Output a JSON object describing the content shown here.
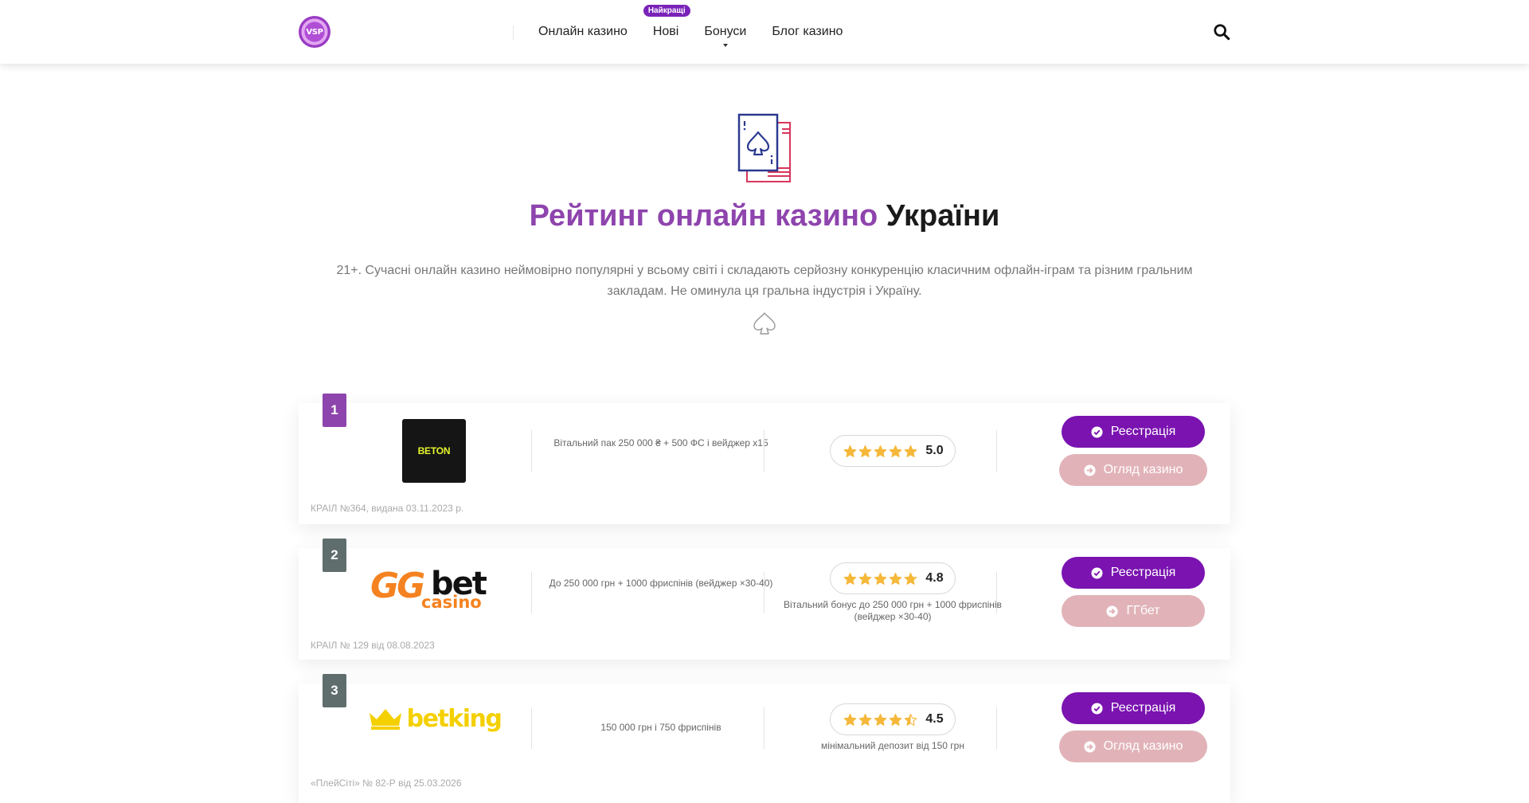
{
  "header": {
    "logo_text": "VSP",
    "nav": [
      {
        "label": "Онлайн казино"
      },
      {
        "label": "Нові",
        "badge": "Найкращі"
      },
      {
        "label": "Бонуси"
      },
      {
        "label": "Блог казино"
      }
    ],
    "search_icon": "search-icon"
  },
  "hero": {
    "icon": "playing-cards-icon",
    "title_accent": "Рейтинг онлайн казино",
    "title_rest": "України",
    "subtitle": "21+. Сучасні онлайн казино неймовірно популярні у всьому світі і складають серйозну конкуренцію класичним офлайн-іграм та різним гральним закладам. Не оминула ця гральна індустрія і Україну.",
    "divider_icon": "spade-outline-icon"
  },
  "casinos": [
    {
      "rank": "1",
      "logo_text": "BETON",
      "bonus": "Вітальний пак 250 000 ₴ + 500 ФС і вейджер x15",
      "rating": 5.0,
      "score": "5.0",
      "rating_note": "",
      "register_label": "Реєстрація",
      "review_label": "Огляд казино",
      "license": "КРАІЛ №364, видана 03.11.2023 р."
    },
    {
      "rank": "2",
      "logo_text": {
        "gg": "GG",
        "bet": "bet",
        "casino": "casino"
      },
      "bonus": "До 250 000 грн + 1000 фриспінів (вейджер ×30-40)",
      "rating": 4.8,
      "score": "4.8",
      "rating_note": "Вітальний бонус до 250 000 грн + 1000 фриспінів (вейджер ×30-40)",
      "register_label": "Реєстрація",
      "review_label": "ГГбет",
      "license": "КРАІЛ № 129 від 08.08.2023"
    },
    {
      "rank": "3",
      "logo_text": "betking",
      "bonus": "150 000 грн і 750 фриспінів",
      "rating": 4.5,
      "score": "4.5",
      "rating_note": "мінімальний депозит від 150 грн",
      "register_label": "Реєстрація",
      "review_label": "Огляд казино",
      "license": "«ПлейСіті» № 82-Р від 25.03.2026"
    }
  ],
  "colors": {
    "accent": "#8e44ad",
    "register_button": "#7a13b0",
    "review_button": "#e1b3b8",
    "star": "#f5b83a",
    "rank_first": "#8e44ad",
    "rank_other": "#5f6d6d"
  }
}
